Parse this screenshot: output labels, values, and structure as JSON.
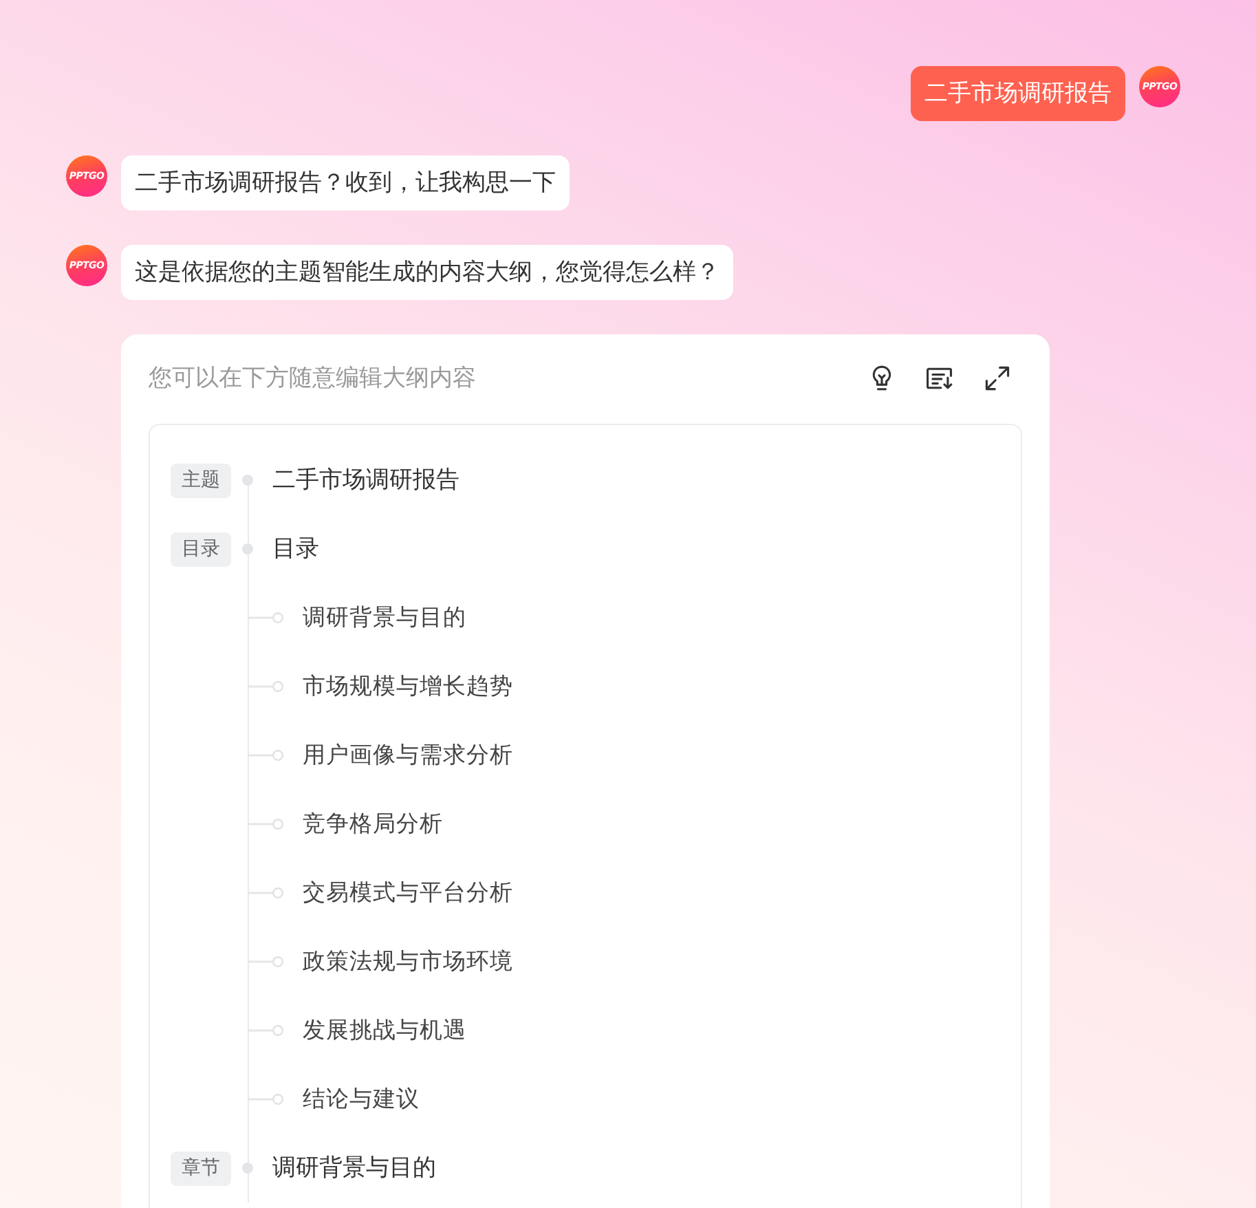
{
  "messages": [
    {
      "kind": "user",
      "avatar": "PPTGO",
      "text": "二手市场调研报告"
    },
    {
      "kind": "bot",
      "avatar": "PPTGO",
      "text": "二手市场调研报告？收到，让我构思一下"
    },
    {
      "kind": "bot",
      "avatar": "PPTGO",
      "text": "这是依据您的主题智能生成的内容大纲，您觉得怎么样？"
    }
  ],
  "outline_card": {
    "hint": "您可以在下方随意编辑大纲内容",
    "outline": [
      {
        "tag": "主题",
        "text": "二手市场调研报告"
      },
      {
        "tag": "目录",
        "text": "目录",
        "children": [
          {
            "text": "调研背景与目的"
          },
          {
            "text": "市场规模与增长趋势"
          },
          {
            "text": "用户画像与需求分析"
          },
          {
            "text": "竞争格局分析"
          },
          {
            "text": "交易模式与平台分析"
          },
          {
            "text": "政策法规与市场环境"
          },
          {
            "text": "发展挑战与机遇"
          },
          {
            "text": "结论与建议"
          }
        ]
      },
      {
        "tag": "章节",
        "text": "调研背景与目的"
      }
    ]
  }
}
